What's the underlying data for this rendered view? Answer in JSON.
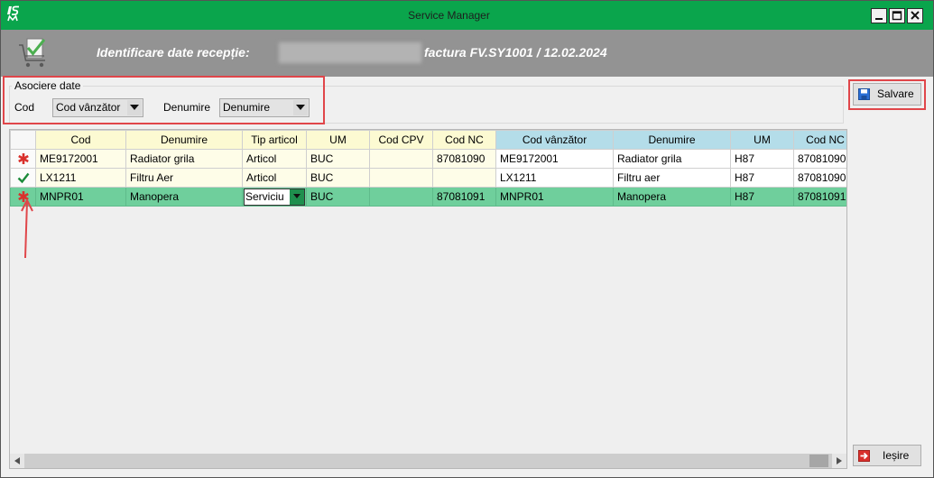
{
  "window": {
    "title": "Service Manager",
    "logo_icon": "app-logo-icon",
    "controls": [
      "minimize-icon",
      "maximize-icon",
      "close-icon"
    ]
  },
  "header": {
    "icon": "cart-check-icon",
    "title": "Identificare date recepție:",
    "invoice": "factura FV.SY1001 / 12.02.2024"
  },
  "association": {
    "label": "Asociere date",
    "cod_label": "Cod",
    "cod_value": "Cod vânzător",
    "denumire_label": "Denumire",
    "denumire_value": "Denumire"
  },
  "actions": {
    "save_label": "Salvare",
    "save_icon": "save-icon",
    "exit_label": "Ieșire",
    "exit_icon": "exit-icon"
  },
  "grid": {
    "columns": [
      "Cod",
      "Denumire",
      "Tip articol",
      "UM",
      "Cod CPV",
      "Cod NC",
      "Cod vânzător",
      "Denumire",
      "UM",
      "Cod NC"
    ],
    "rows": [
      {
        "status_icon": "asterisk-icon",
        "selected": false,
        "cells": [
          "ME9172001",
          "Radiator grila",
          "Articol",
          "BUC",
          "",
          "87081090",
          "ME9172001",
          "Radiator grila",
          "H87",
          "87081090"
        ]
      },
      {
        "status_icon": "check-icon",
        "selected": false,
        "cells": [
          "LX1211",
          "Filtru Aer",
          "Articol",
          "BUC",
          "",
          "",
          "LX1211",
          "Filtru aer",
          "H87",
          "87081090"
        ]
      },
      {
        "status_icon": "asterisk-icon",
        "selected": true,
        "cells": [
          "MNPR01",
          "Manopera",
          "Serviciu",
          "BUC",
          "",
          "87081091",
          "MNPR01",
          "Manopera",
          "H87",
          "87081091"
        ]
      }
    ]
  },
  "colors": {
    "title_bar": "#0aa54c",
    "header_band": "#939393",
    "left_header": "#fcfad2",
    "right_header": "#b4dde9",
    "left_cells": "#fefde8",
    "selected_row": "#6fcf9c",
    "edit_button": "#1f8f4e",
    "asterisk": "#d9302c",
    "check": "#1b8a3a",
    "annotation": "#e0464a"
  }
}
